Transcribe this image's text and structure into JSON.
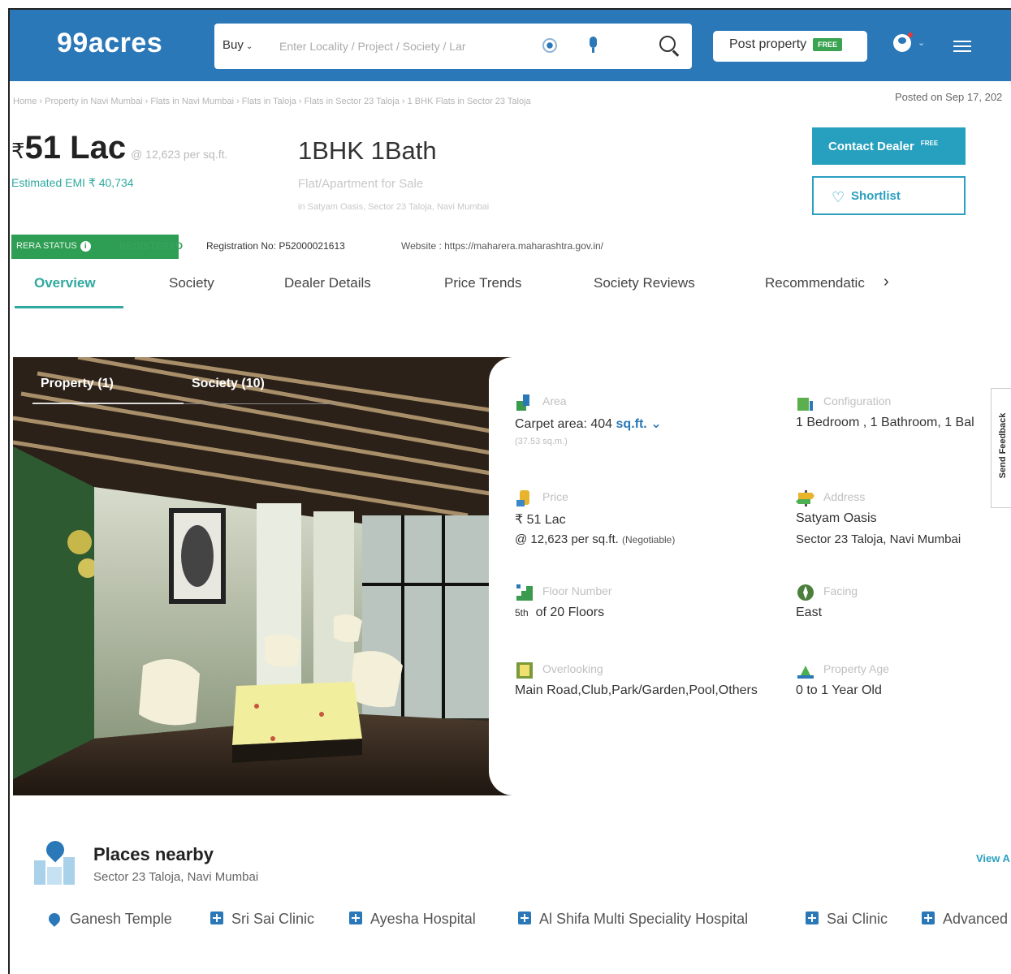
{
  "header": {
    "logo": "99acres",
    "search": {
      "mode": "Buy",
      "placeholder": "Enter Locality / Project / Society / Lar"
    },
    "post_property": "Post property",
    "post_badge": "FREE"
  },
  "breadcrumb": "Home › Property in Navi Mumbai › Flats in Navi Mumbai › Flats in Taloja › Flats in Sector 23 Taloja › 1 BHK Flats in Sector 23 Taloja",
  "posted_on": "Posted on Sep 17, 202",
  "listing": {
    "rupee": "₹",
    "price": "51 Lac",
    "price_per_sqft": "@ 12,623 per sq.ft.",
    "emi": "Estimated EMI ₹ 40,734",
    "title": "1BHK 1Bath",
    "type": "Flat/Apartment for Sale",
    "address_line": "in Satyam Oasis, Sector 23 Taloja, Navi Mumbai"
  },
  "actions": {
    "contact": "Contact Dealer",
    "contact_badge": "FREE",
    "shortlist": "Shortlist"
  },
  "rera": {
    "label": "RERA STATUS",
    "status": "REGISTERED",
    "registration": "Registration No: P52000021613",
    "website": "Website : https://maharera.maharashtra.gov.in/"
  },
  "tabs": [
    {
      "label": "Overview"
    },
    {
      "label": "Society"
    },
    {
      "label": "Dealer Details"
    },
    {
      "label": "Price Trends"
    },
    {
      "label": "Society Reviews"
    },
    {
      "label": "Recommendatic"
    }
  ],
  "gallery": {
    "tabs": [
      {
        "label": "Property (1)"
      },
      {
        "label": "Society (10)"
      }
    ]
  },
  "details": {
    "area": {
      "label": "Area",
      "value": "Carpet area: 404",
      "unit": "sq.ft.",
      "sub": "(37.53 sq.m.)"
    },
    "configuration": {
      "label": "Configuration",
      "value": "1 Bedroom , 1 Bathroom, 1 Bal"
    },
    "price": {
      "label": "Price",
      "value": "₹ 51 Lac",
      "sub": "@ 12,623 per sq.ft.",
      "note": "(Negotiable)"
    },
    "address": {
      "label": "Address",
      "value": "Satyam Oasis",
      "sub": "Sector 23 Taloja, Navi Mumbai"
    },
    "floor": {
      "label": "Floor Number",
      "value_sup": "5th",
      "value": "of 20 Floors"
    },
    "facing": {
      "label": "Facing",
      "value": "East"
    },
    "overlooking": {
      "label": "Overlooking",
      "value": "Main Road,Club,Park/Garden,Pool,Others"
    },
    "age": {
      "label": "Property Age",
      "value": "0 to 1 Year Old"
    }
  },
  "feedback": "Send Feedback",
  "places": {
    "title": "Places nearby",
    "subtitle": "Sector 23 Taloja, Navi Mumbai",
    "view_all": "View A",
    "items": [
      {
        "label": "Ganesh Temple"
      },
      {
        "label": "Sri Sai Clinic"
      },
      {
        "label": "Ayesha Hospital"
      },
      {
        "label": "Al Shifa Multi Speciality Hospital"
      },
      {
        "label": "Sai Clinic"
      },
      {
        "label": "Advanced"
      }
    ]
  },
  "colors": {
    "header_blue": "#2a78b8",
    "teal": "#2fa9a0",
    "rera_green": "#2f9e55",
    "contact_btn": "#26a0be"
  }
}
